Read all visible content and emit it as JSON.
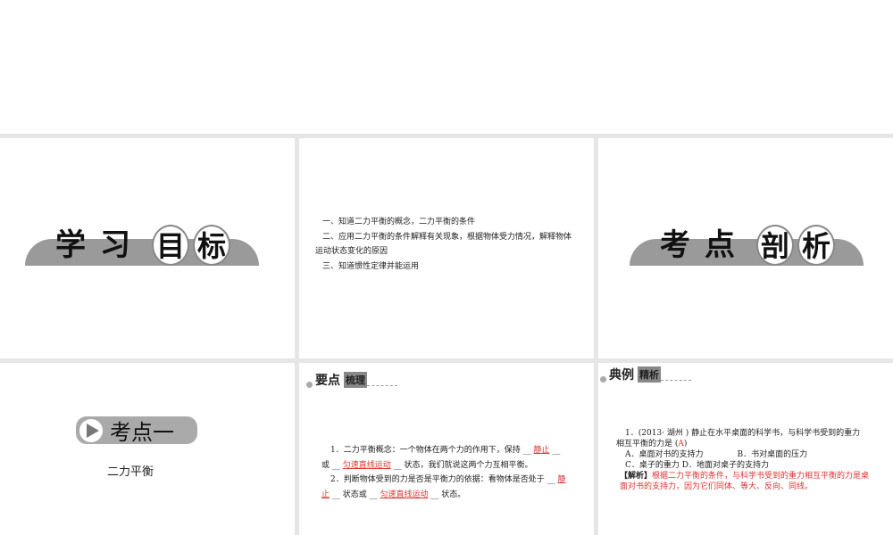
{
  "slide1": {
    "title_chars": [
      "学",
      "习",
      "目",
      "标"
    ]
  },
  "slide2": {
    "lines": [
      "一、知道二力平衡的概念，二力平衡的条件",
      "二、应用二力平衡的条件解释有关现象，根据物体受力情况，解释物体",
      "运动状态变化的原因",
      "三、知道惯性定律并能运用"
    ]
  },
  "slide3": {
    "title_chars": [
      "考",
      "点",
      "剖",
      "析"
    ]
  },
  "slide4": {
    "badge": "考点一",
    "subtitle": "二力平衡"
  },
  "slide5": {
    "header": "要点",
    "header_box": "梳理",
    "p1a": "1．二力平衡概念：一个物体在两个力的作用下，保持 __ ",
    "p1b": "静止",
    "p1c": " __",
    "p1d": "或 __ ",
    "p1e": "匀速直线运动",
    "p1f": " __ 状态，我们就说这两个力互相平衡。",
    "p2a": "2．判断物体受到的力是否是平衡力的依据：看物体是否处于 __ ",
    "p2b": "静",
    "p2c": "止",
    "p2d": " __ 状态或 __ ",
    "p2e": "匀速直线运动",
    "p2f": " __ 状态。"
  },
  "slide6": {
    "header": "典例",
    "header_box": "精析",
    "q1": "1．(2013· 湖州 ) 静止在水平桌面的科学书，与科学书受到的重力",
    "q2": "相互平衡的力是 (",
    "ans": "A",
    "q2b": ")",
    "optA": "A．桌面对书的支持力",
    "optB": "B．书对桌面的压力",
    "optCD": "C．桌子的重力  D．地面对桌子的支持力",
    "jx": "【解析】",
    "jx_text": "根据二力平衡的条件，与科学书受到的重力相互平衡的力是桌面对书的支持力，因为它们同体、等大、反向、同线。"
  }
}
